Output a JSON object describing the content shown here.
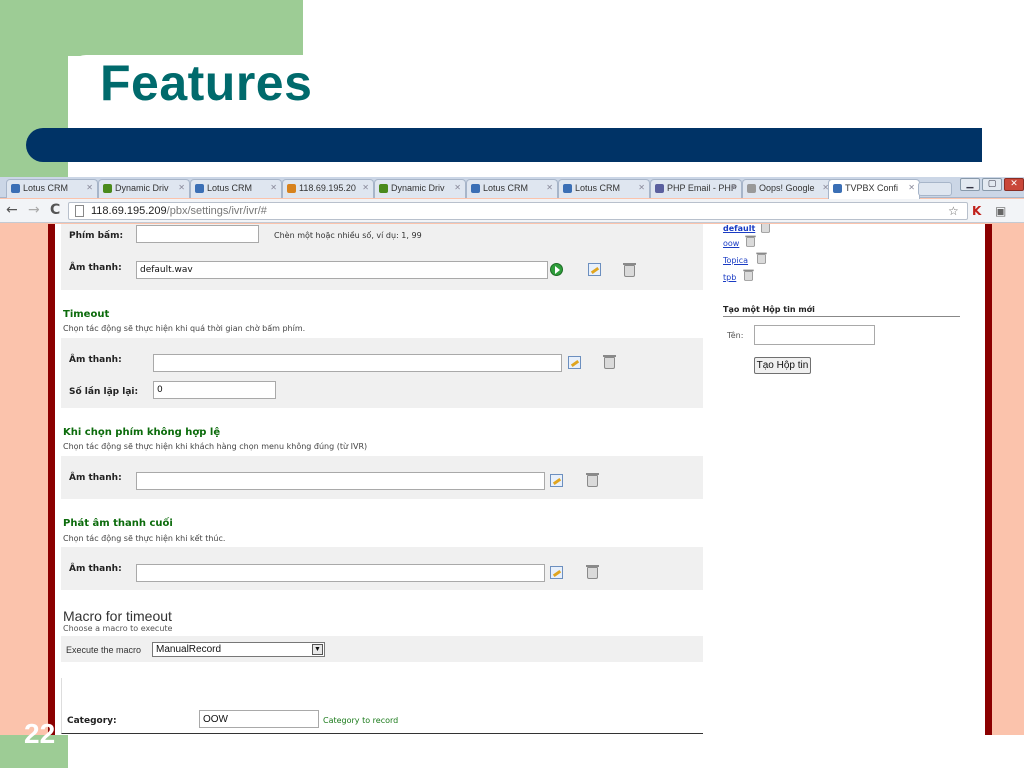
{
  "slide": {
    "title": "Features",
    "number": "22"
  },
  "browser": {
    "tabs": [
      {
        "label": "Lotus CRM",
        "favicon_color": "#3b6fb5"
      },
      {
        "label": "Dynamic Driv",
        "favicon_color": "#4a8a1c"
      },
      {
        "label": "Lotus CRM",
        "favicon_color": "#3b6fb5"
      },
      {
        "label": "118.69.195.20",
        "favicon_color": "#d7821d"
      },
      {
        "label": "Dynamic Driv",
        "favicon_color": "#4a8a1c"
      },
      {
        "label": "Lotus CRM",
        "favicon_color": "#3b6fb5"
      },
      {
        "label": "Lotus CRM",
        "favicon_color": "#3b6fb5"
      },
      {
        "label": "PHP Email - PHP",
        "favicon_color": "#5a5f9e"
      },
      {
        "label": "Oops! Google",
        "favicon_color": "#999999"
      },
      {
        "label": "TVPBX Confi",
        "favicon_color": "#3b6fb5",
        "active": true
      }
    ],
    "url_host": "118.69.195.209",
    "url_path": "/pbx/settings/ivr/ivr/#"
  },
  "form": {
    "key_label": "Phím bấm:",
    "key_value": "",
    "key_hint": "Chèn một hoặc nhiều số, ví dụ: 1, 99",
    "sound_label": "Âm thanh:",
    "sound_value": "default.wav",
    "timeout": {
      "title": "Timeout",
      "desc": "Chọn tác động sẽ thực hiện khi quá thời gian chờ bấm phím.",
      "sound_label": "Âm thanh:",
      "sound_value": "",
      "repeat_label": "Số lần lặp lại:",
      "repeat_value": "0"
    },
    "invalid": {
      "title": "Khi chọn phím không hợp lệ",
      "desc": "Chọn tác động sẽ thực hiện khi khách hàng chọn menu không đúng (từ IVR)",
      "sound_label": "Âm thanh:",
      "sound_value": ""
    },
    "final_sound": {
      "title": "Phát âm thanh cuối",
      "desc": "Chọn tác động sẽ thực hiện khi kết thúc.",
      "sound_label": "Âm thanh:",
      "sound_value": ""
    },
    "macro": {
      "title": "Macro for timeout",
      "desc": "Choose a macro to execute",
      "execute_label": "Execute the macro",
      "selected": "ManualRecord"
    },
    "category": {
      "label": "Category:",
      "value": "OOW",
      "hint": "Category to record"
    }
  },
  "sidebar": {
    "mailboxes": [
      "default",
      "oow",
      "Topica",
      "tpb"
    ],
    "new_mailbox_title": "Tạo một Hộp tin mới",
    "name_label": "Tên:",
    "name_value": "",
    "create_button": "Tạo Hộp tin"
  }
}
